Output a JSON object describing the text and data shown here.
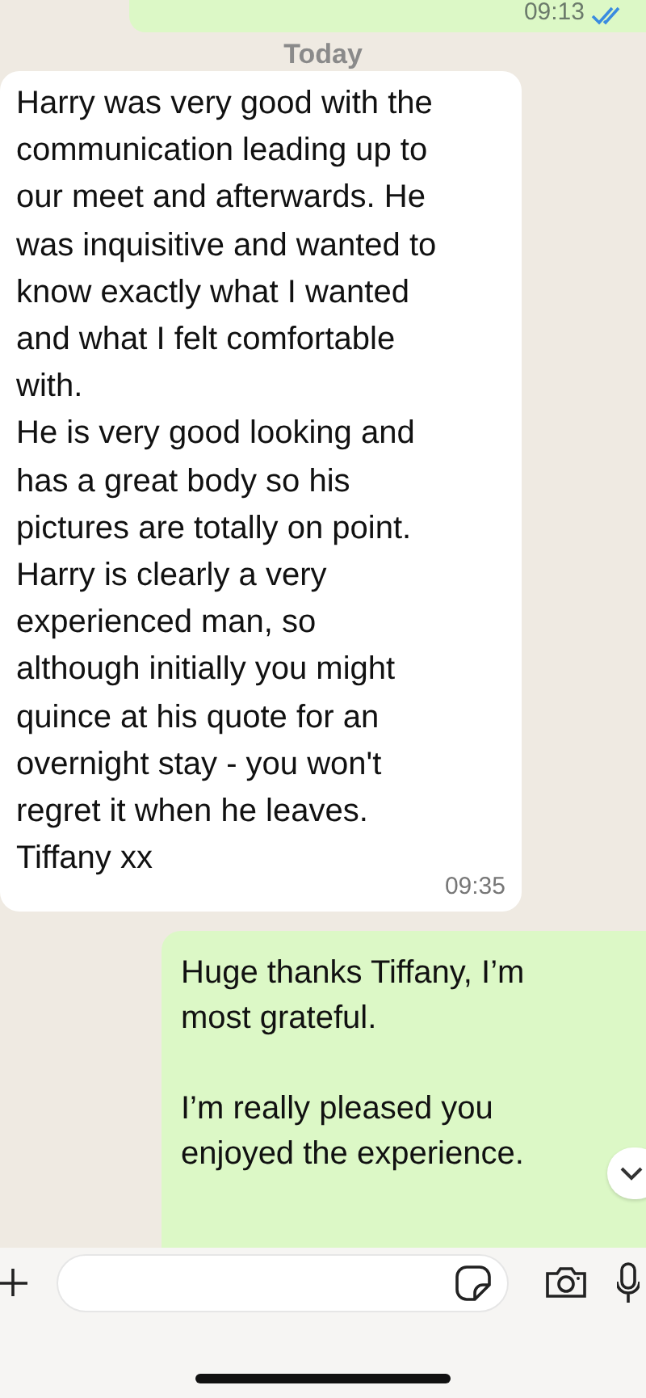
{
  "messages": [
    {
      "kind": "sent",
      "time": "09:13",
      "read": true
    },
    {
      "kind": "date",
      "text": "Today"
    },
    {
      "kind": "received",
      "text": "Harry was very good with the\ncommunication leading up to\nour meet and afterwards. He\nwas inquisitive and wanted to\nknow exactly what I wanted\nand what I felt comfortable\nwith.\nHe is very good looking and\nhas a great body so his\npictures are totally on point.\nHarry is clearly a very\nexperienced man, so\nalthough initially you might\nquince at his quote for an\novernight stay - you won't\nregret it when he leaves.\nTiffany xx",
      "time": "09:35"
    },
    {
      "kind": "sent",
      "text": "Huge thanks Tiffany, I’m\nmost grateful.\n\nI’m really pleased you\nenjoyed the experience."
    }
  ]
}
